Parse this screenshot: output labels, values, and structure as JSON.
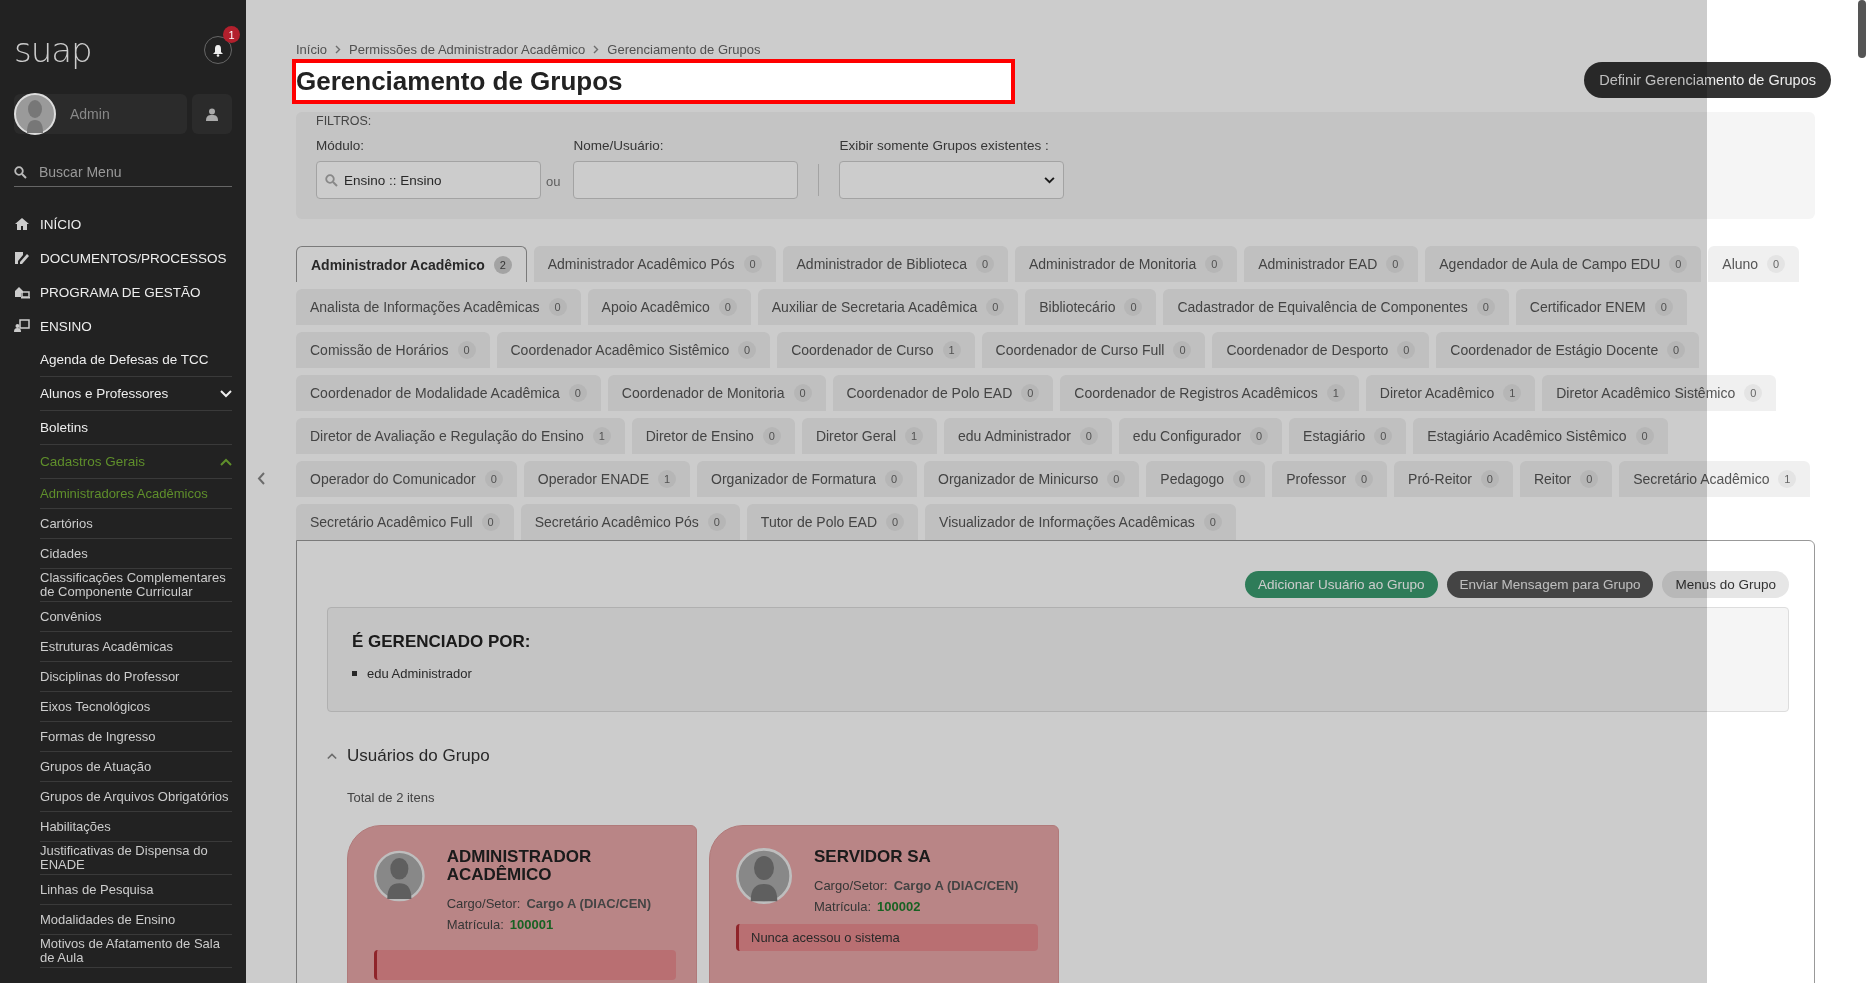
{
  "sidebar": {
    "logo": "suap",
    "notifications": "1",
    "user": "Admin",
    "search": {
      "placeholder": "Buscar Menu"
    },
    "menu": [
      {
        "label": "INÍCIO",
        "selected": false
      },
      {
        "label": "DOCUMENTOS/PROCESSOS",
        "selected": false
      },
      {
        "label": "PROGRAMA DE GESTÃO",
        "selected": false
      },
      {
        "label": "ENSINO",
        "selected": false,
        "children": [
          {
            "label": "Agenda de Defesas de TCC",
            "selected": false
          },
          {
            "label": "Alunos e Professores",
            "selected": false,
            "expanded": false
          },
          {
            "label": "Boletins",
            "selected": false
          },
          {
            "label": "Cadastros Gerais",
            "selected": true,
            "expanded": true,
            "children": [
              {
                "label": "Administradores Acadêmicos",
                "selected": true
              },
              {
                "label": "Cartórios",
                "selected": false
              },
              {
                "label": "Cidades",
                "selected": false
              },
              {
                "label": "Classificações Complementares de Componente Curricular",
                "selected": false
              },
              {
                "label": "Convênios",
                "selected": false
              },
              {
                "label": "Estruturas Acadêmicas",
                "selected": false
              },
              {
                "label": "Disciplinas do Professor",
                "selected": false
              },
              {
                "label": "Eixos Tecnológicos",
                "selected": false
              },
              {
                "label": "Formas de Ingresso",
                "selected": false
              },
              {
                "label": "Grupos de Atuação",
                "selected": false
              },
              {
                "label": "Grupos de Arquivos Obrigatórios",
                "selected": false
              },
              {
                "label": "Habilitações",
                "selected": false
              },
              {
                "label": "Justificativas de Dispensa do ENADE",
                "selected": false
              },
              {
                "label": "Linhas de Pesquisa",
                "selected": false
              },
              {
                "label": "Modalidades de Ensino",
                "selected": false
              },
              {
                "label": "Motivos de Afatamento de Sala de Aula",
                "selected": false
              }
            ]
          }
        ]
      }
    ]
  },
  "breadcrumbs": [
    "Início",
    "Permissões de Administrador Acadêmico",
    "Gerenciamento de Grupos"
  ],
  "title": "Gerenciamento de Grupos",
  "action_button": "Definir Gerenciamento de Grupos",
  "filters": {
    "legend": "FILTROS:",
    "modulo": {
      "label": "Módulo:",
      "value": "Ensino :: Ensino"
    },
    "separator": "ou",
    "nome": {
      "label": "Nome/Usuário:"
    },
    "existentes": {
      "label": "Exibir somente Grupos existentes :"
    }
  },
  "tabs": [
    {
      "label": "Administrador Acadêmico",
      "count": "2",
      "selected": true
    },
    {
      "label": "Administrador Acadêmico Pós",
      "count": "0",
      "selected": false
    },
    {
      "label": "Administrador de Biblioteca",
      "count": "0",
      "selected": false
    },
    {
      "label": "Administrador de Monitoria",
      "count": "0",
      "selected": false
    },
    {
      "label": "Administrador EAD",
      "count": "0",
      "selected": false
    },
    {
      "label": "Agendador de Aula de Campo EDU",
      "count": "0",
      "selected": false
    },
    {
      "label": "Aluno",
      "count": "0",
      "selected": false
    },
    {
      "label": "Analista de Informações Acadêmicas",
      "count": "0",
      "selected": false
    },
    {
      "label": "Apoio Acadêmico",
      "count": "0",
      "selected": false
    },
    {
      "label": "Auxiliar de Secretaria Acadêmica",
      "count": "0",
      "selected": false
    },
    {
      "label": "Bibliotecário",
      "count": "0",
      "selected": false
    },
    {
      "label": "Cadastrador de Equivalência de Componentes",
      "count": "0",
      "selected": false
    },
    {
      "label": "Certificador ENEM",
      "count": "0",
      "selected": false
    },
    {
      "label": "Comissão de Horários",
      "count": "0",
      "selected": false
    },
    {
      "label": "Coordenador Acadêmico Sistêmico",
      "count": "0",
      "selected": false
    },
    {
      "label": "Coordenador de Curso",
      "count": "1",
      "selected": false
    },
    {
      "label": "Coordenador de Curso Full",
      "count": "0",
      "selected": false
    },
    {
      "label": "Coordenador de Desporto",
      "count": "0",
      "selected": false
    },
    {
      "label": "Coordenador de Estágio Docente",
      "count": "0",
      "selected": false
    },
    {
      "label": "Coordenador de Modalidade Acadêmica",
      "count": "0",
      "selected": false
    },
    {
      "label": "Coordenador de Monitoria",
      "count": "0",
      "selected": false
    },
    {
      "label": "Coordenador de Polo EAD",
      "count": "0",
      "selected": false
    },
    {
      "label": "Coordenador de Registros Acadêmicos",
      "count": "1",
      "selected": false
    },
    {
      "label": "Diretor Acadêmico",
      "count": "1",
      "selected": false
    },
    {
      "label": "Diretor Acadêmico Sistêmico",
      "count": "0",
      "selected": false
    },
    {
      "label": "Diretor de Avaliação e Regulação do Ensino",
      "count": "1",
      "selected": false
    },
    {
      "label": "Diretor de Ensino",
      "count": "0",
      "selected": false
    },
    {
      "label": "Diretor Geral",
      "count": "1",
      "selected": false
    },
    {
      "label": "edu Administrador",
      "count": "0",
      "selected": false
    },
    {
      "label": "edu Configurador",
      "count": "0",
      "selected": false
    },
    {
      "label": "Estagiário",
      "count": "0",
      "selected": false
    },
    {
      "label": "Estagiário Acadêmico Sistêmico",
      "count": "0",
      "selected": false
    },
    {
      "label": "Operador do Comunicador",
      "count": "0",
      "selected": false
    },
    {
      "label": "Operador ENADE",
      "count": "1",
      "selected": false
    },
    {
      "label": "Organizador de Formatura",
      "count": "0",
      "selected": false
    },
    {
      "label": "Organizador de Minicurso",
      "count": "0",
      "selected": false
    },
    {
      "label": "Pedagogo",
      "count": "0",
      "selected": false
    },
    {
      "label": "Professor",
      "count": "0",
      "selected": false
    },
    {
      "label": "Pró-Reitor",
      "count": "0",
      "selected": false
    },
    {
      "label": "Reitor",
      "count": "0",
      "selected": false
    },
    {
      "label": "Secretário Acadêmico",
      "count": "1",
      "selected": false
    },
    {
      "label": "Secretário Acadêmico Full",
      "count": "0",
      "selected": false
    },
    {
      "label": "Secretário Acadêmico Pós",
      "count": "0",
      "selected": false
    },
    {
      "label": "Tutor de Polo EAD",
      "count": "0",
      "selected": false
    },
    {
      "label": "Visualizador de Informações Acadêmicas",
      "count": "0",
      "selected": false
    }
  ],
  "panel": {
    "buttons": [
      {
        "label": "Adicionar Usuário ao Grupo",
        "kind": "success"
      },
      {
        "label": "Enviar Mensagem para Grupo",
        "kind": "dark"
      },
      {
        "label": "Menus do Grupo",
        "kind": "light"
      }
    ],
    "managed_by": {
      "title": "É GERENCIADO POR:",
      "items": [
        "edu Administrador"
      ]
    },
    "users_section": {
      "title": "Usuários do Grupo",
      "expanded": true,
      "total": "Total de 2 itens",
      "users": [
        {
          "name": "ADMINISTRADOR ACADÊMICO",
          "cargo_label": "Cargo/Setor:",
          "cargo": "Cargo A (DIAC/CEN)",
          "matricula_label": "Matrícula:",
          "matricula": "100001"
        },
        {
          "name": "SERVIDOR SA",
          "cargo_label": "Cargo/Setor:",
          "cargo": "Cargo A (DIAC/CEN)",
          "matricula_label": "Matrícula:",
          "matricula": "100002",
          "alert": "Nunca acessou o sistema"
        }
      ]
    }
  }
}
